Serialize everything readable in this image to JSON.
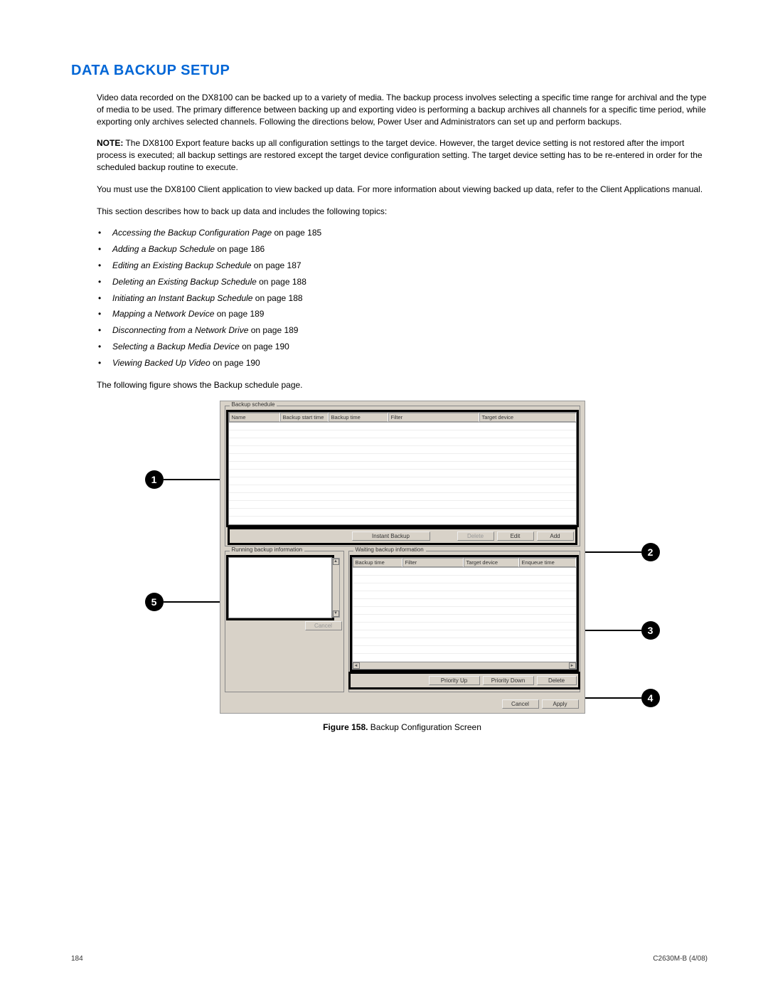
{
  "heading": "DATA BACKUP SETUP",
  "paragraphs": {
    "p1": "Video data recorded on the DX8100 can be backed up to a variety of media. The backup process involves selecting a specific time range for archival and the type of media to be used. The primary difference between backing up and exporting video is performing a backup archives all channels for a specific time period, while exporting only archives selected channels. Following the directions below, Power User and Administrators can set up and perform backups.",
    "note_label": "NOTE:",
    "note_body": " The DX8100 Export feature backs up all configuration settings to the target device. However, the target device setting is not restored after the import process is executed; all backup settings are restored except the target device configuration setting. The target device setting has to be re-entered in order for the scheduled backup routine to execute.",
    "p3": "You must use the DX8100 Client application to view backed up data. For more information about viewing backed up data, refer to the Client Applications manual.",
    "p4": "This section describes how to back up data and includes the following topics:",
    "p5": "The following figure shows the Backup schedule page."
  },
  "topics": [
    {
      "title": "Accessing the Backup Configuration Page",
      "suffix": " on page 185"
    },
    {
      "title": "Adding a Backup Schedule",
      "suffix": " on page 186"
    },
    {
      "title": "Editing an Existing Backup Schedule",
      "suffix": " on page 187"
    },
    {
      "title": "Deleting an Existing Backup Schedule",
      "suffix": " on page 188"
    },
    {
      "title": "Initiating an Instant Backup Schedule",
      "suffix": " on page 188"
    },
    {
      "title": "Mapping a Network Device",
      "suffix": " on page 189"
    },
    {
      "title": "Disconnecting from a Network Drive",
      "suffix": " on page 189"
    },
    {
      "title": "Selecting a Backup Media Device",
      "suffix": " on page 190"
    },
    {
      "title": "Viewing Backed Up Video",
      "suffix": " on page 190"
    }
  ],
  "screenshot": {
    "backup_schedule_legend": "Backup schedule",
    "schedule_cols": {
      "name": "Name",
      "start": "Backup start time",
      "time": "Backup time",
      "filter": "Filter",
      "target": "Target device"
    },
    "schedule_buttons": {
      "instant": "Instant Backup",
      "delete": "Delete",
      "edit": "Edit",
      "add": "Add"
    },
    "running_legend": "Running backup information",
    "running_cancel": "Cancel",
    "waiting_legend": "Waiting backup information",
    "waiting_cols": {
      "time": "Backup time",
      "filter": "Filter",
      "target": "Target device",
      "enqueue": "Enqueue time"
    },
    "waiting_buttons": {
      "pup": "Priority Up",
      "pdown": "Priority Down",
      "delete": "Delete"
    },
    "final_buttons": {
      "cancel": "Cancel",
      "apply": "Apply"
    }
  },
  "callouts": {
    "c1": "1",
    "c2": "2",
    "c3": "3",
    "c4": "4",
    "c5": "5"
  },
  "figure": {
    "label": "Figure 158.",
    "caption": "  Backup Configuration Screen"
  },
  "footer": {
    "page": "184",
    "doc": "C2630M-B (4/08)"
  }
}
